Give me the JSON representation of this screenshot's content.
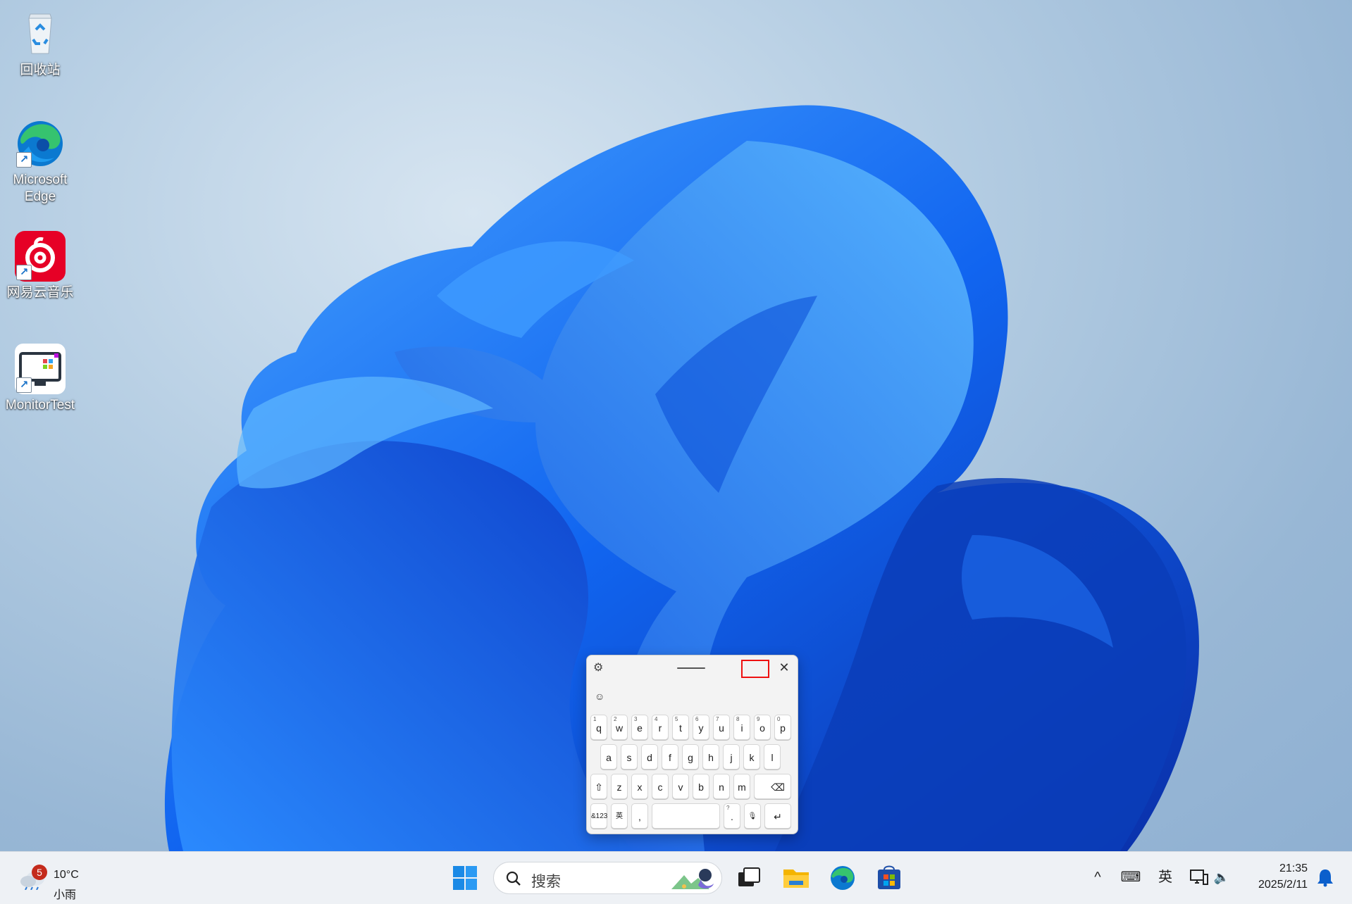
{
  "desktop": {
    "icons": [
      {
        "label": "回收站",
        "icon": "recycle-bin-icon"
      },
      {
        "label": "Microsoft Edge",
        "icon": "edge-icon"
      },
      {
        "label": "网易云音乐",
        "icon": "netease-music-icon"
      },
      {
        "label": "MonitorTest",
        "icon": "monitortest-icon"
      }
    ]
  },
  "keyboard": {
    "gear_icon": "⚙",
    "close_icon": "✕",
    "emoji_icon": "☺",
    "row1": [
      {
        "key": "q",
        "hint": "1"
      },
      {
        "key": "w",
        "hint": "2"
      },
      {
        "key": "e",
        "hint": "3"
      },
      {
        "key": "r",
        "hint": "4"
      },
      {
        "key": "t",
        "hint": "5"
      },
      {
        "key": "y",
        "hint": "6"
      },
      {
        "key": "u",
        "hint": "7"
      },
      {
        "key": "i",
        "hint": "8"
      },
      {
        "key": "o",
        "hint": "9"
      },
      {
        "key": "p",
        "hint": "0"
      }
    ],
    "row2": [
      "a",
      "s",
      "d",
      "f",
      "g",
      "h",
      "j",
      "k",
      "l"
    ],
    "row3": [
      "z",
      "x",
      "c",
      "v",
      "b",
      "n",
      "m"
    ],
    "row4": {
      "symbols": "&123",
      "lang": "英",
      "comma": ",",
      "period": ".",
      "period_hint": "?"
    },
    "shift": "⇧",
    "backspace": "⌫",
    "mic": "🎙",
    "enter": "↵"
  },
  "taskbar": {
    "weather": {
      "badge": "5",
      "temp": "10°C",
      "condition": "小雨"
    },
    "search_placeholder": "搜索",
    "tray": {
      "chevron": "^",
      "keyboard_icon": "⌨",
      "ime": "英",
      "volume": "🔈"
    },
    "clock": {
      "time": "21:35",
      "date": "2025/2/11"
    }
  },
  "colors": {
    "accent": "#0067c0",
    "edge_blue": "#0b79d0",
    "netease_red": "#e60026"
  }
}
